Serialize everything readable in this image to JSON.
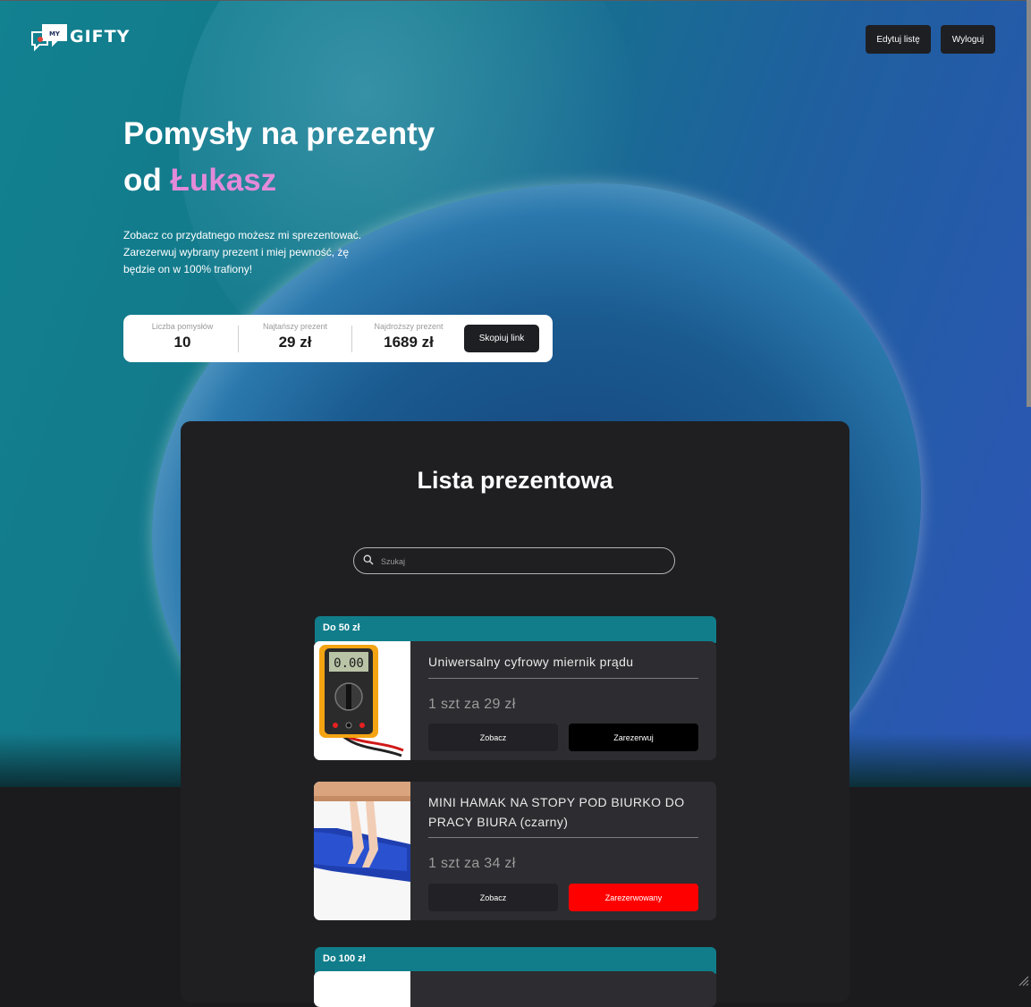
{
  "header": {
    "logo_my": "MY",
    "logo_text": "GIFTY",
    "edit_label": "Edytuj listę",
    "logout_label": "Wyloguj"
  },
  "hero": {
    "title_line1": "Pomysły na prezenty",
    "title_prefix": "od",
    "title_name": "Łukasz",
    "description": "Zobacz co przydatnego możesz mi sprezentować. Zarezerwuj wybrany prezent i miej pewność, żę będzie on w 100% trafiony!",
    "accent_color": "#e38ad9"
  },
  "stats": {
    "items": [
      {
        "label": "Liczba pomysłów",
        "value": "10"
      },
      {
        "label": "Najtańszy prezent",
        "value": "29 zł"
      },
      {
        "label": "Najdroższy prezent",
        "value": "1689 zł"
      }
    ],
    "copy_label": "Skopiuj link"
  },
  "list": {
    "title": "Lista prezentowa",
    "search_placeholder": "Szukaj",
    "categories": [
      {
        "label": "Do 50 zł"
      },
      {
        "label": "Do 100 zł"
      }
    ],
    "items": [
      {
        "name": "Uniwersalny cyfrowy miernik prądu",
        "price": "1 szt za 29 zł",
        "see_label": "Zobacz",
        "action_label": "Zarezerwuj",
        "image": "multimeter-image",
        "display": "0.00"
      },
      {
        "name": "MINI HAMAK NA STOPY POD BIURKO DO PRACY BIURA (czarny)",
        "price": "1 szt za 34 zł",
        "see_label": "Zobacz",
        "action_label": "Zarezerwowany",
        "image": "foot-hammock-image"
      }
    ]
  },
  "colors": {
    "category_bar": "#117d8a",
    "reserved": "#ff0000",
    "panel": "#1f1f22",
    "card": "#2d2d31"
  }
}
